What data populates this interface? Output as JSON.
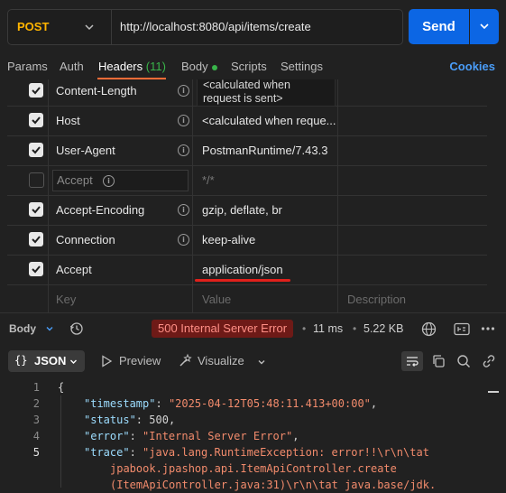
{
  "request": {
    "method": "POST",
    "url": "http://localhost:8080/api/items/create",
    "send_label": "Send"
  },
  "tabs": [
    {
      "label": "Params"
    },
    {
      "label": "Auth"
    },
    {
      "label": "Headers",
      "count": "(11)"
    },
    {
      "label": "Body"
    },
    {
      "label": "Scripts"
    },
    {
      "label": "Settings"
    }
  ],
  "cookies_label": "Cookies",
  "headers": {
    "rows": [
      {
        "checked": true,
        "key": "Content-Length",
        "value_line1": "<calculated when",
        "value_line2": "request is sent>"
      },
      {
        "checked": true,
        "key": "Host",
        "value": "<calculated when reque..."
      },
      {
        "checked": true,
        "key": "User-Agent",
        "value": "PostmanRuntime/7.43.3"
      },
      {
        "checked": false,
        "key": "Accept",
        "value": "*/*"
      },
      {
        "checked": true,
        "key": "Accept-Encoding",
        "value": "gzip, deflate, br"
      },
      {
        "checked": true,
        "key": "Connection",
        "value": "keep-alive"
      },
      {
        "checked": true,
        "key": "Accept",
        "value": "application/json"
      }
    ],
    "placeholder": {
      "key": "Key",
      "value": "Value",
      "description": "Description"
    }
  },
  "response": {
    "body_label": "Body",
    "status": "500 Internal Server Error",
    "time": "11 ms",
    "size": "5.22 KB",
    "view_format": "JSON",
    "view_tabs": [
      "Preview",
      "Visualize"
    ],
    "lines": [
      {
        "n": "1",
        "text": "{"
      },
      {
        "n": "2",
        "key": "\"timestamp\"",
        "value": "\"2025-04-12T05:48:11.413+00:00\""
      },
      {
        "n": "3",
        "key": "\"status\"",
        "value": "500"
      },
      {
        "n": "4",
        "key": "\"error\"",
        "value": "\"Internal Server Error\""
      },
      {
        "n": "5",
        "key": "\"trace\"",
        "value": "\"java.lang.RuntimeException: error!!\\r\\n\\tat",
        "wrap1": "jpabook.jpashop.api.ItemApiController.create",
        "wrap2": "(ItemApiController.java:31)\\r\\n\\tat java.base/jdk."
      }
    ]
  },
  "colors": {
    "accent": "#ff6c37",
    "send": "#0c66e4",
    "method": "#ffb400",
    "error_bg": "#6e1a17",
    "error_text": "#ff8f86",
    "highlight_underline": "#e0201b"
  }
}
